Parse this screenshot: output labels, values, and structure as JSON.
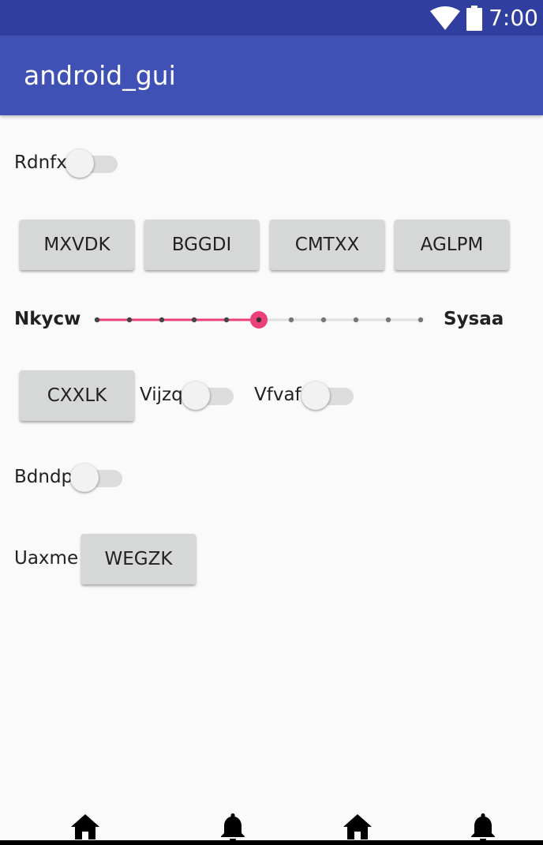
{
  "status_bar": {
    "time": "7:00",
    "icons": [
      "wifi-icon",
      "battery-icon"
    ]
  },
  "app_bar": {
    "title": "android_gui"
  },
  "row1": {
    "switch_label": "Rdnfx",
    "switch_on": false
  },
  "buttons_row": [
    "MXVDK",
    "BGGDI",
    "CMTXX",
    "AGLPM"
  ],
  "seekbar": {
    "left_label": "Nkycw",
    "right_label": "Sysaa",
    "max": 10,
    "value": 5,
    "accent": "#ec407a"
  },
  "row4": {
    "button": "CXXLK",
    "switch1_label": "Vijzq",
    "switch1_on": false,
    "switch2_label": "Vfvaf",
    "switch2_on": false
  },
  "row5": {
    "switch_label": "Bdndp",
    "switch_on": false
  },
  "row6": {
    "label": "Uaxme",
    "button": "WEGZK"
  },
  "bottom_nav": [
    "home-icon",
    "bell-icon",
    "home-icon",
    "bell-icon"
  ],
  "colors": {
    "primary": "#3f51b5",
    "primary_dark": "#303f9f",
    "accent": "#ec407a"
  }
}
